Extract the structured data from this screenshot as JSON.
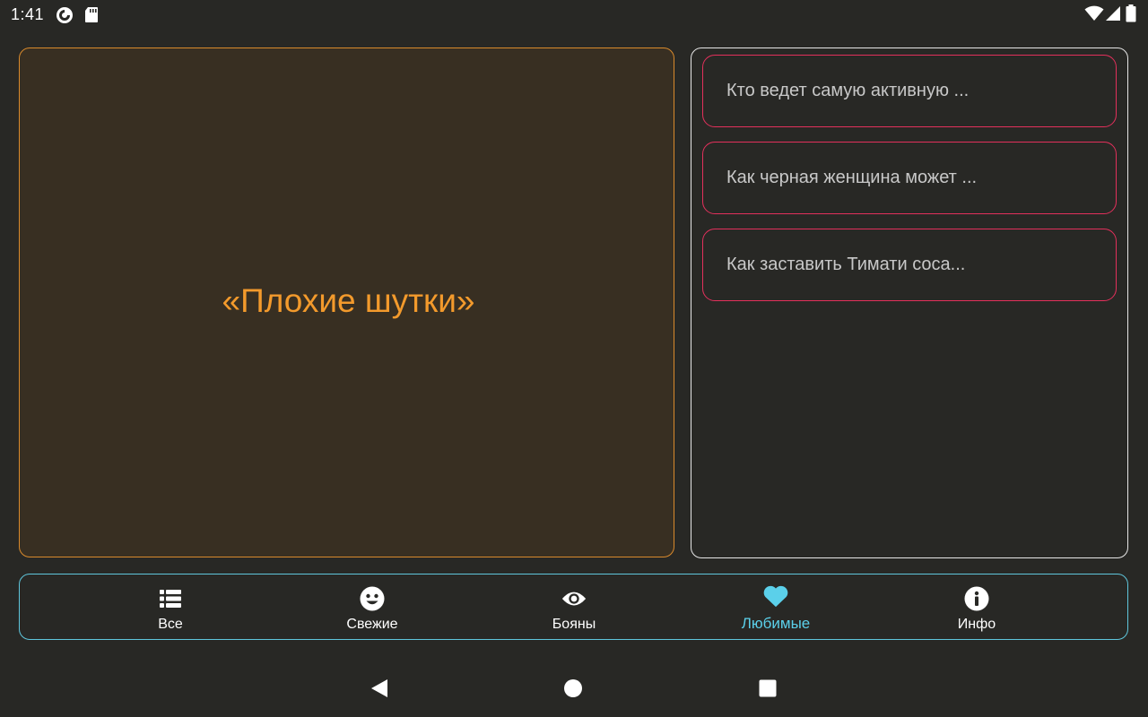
{
  "status_bar": {
    "time": "1:41",
    "icons": [
      "pocket-casts-icon",
      "sd-card-icon",
      "wifi-icon",
      "cell-signal-icon",
      "battery-icon"
    ]
  },
  "main_card": {
    "title": "«Плохие шутки»",
    "accent_color": "#f39a2c"
  },
  "list": {
    "items": [
      {
        "label": "Кто ведет самую активную ..."
      },
      {
        "label": "Как черная женщина может ..."
      },
      {
        "label": "Как заставить Тимати соса..."
      }
    ],
    "border_color": "#e3305c"
  },
  "bottom_nav": {
    "items": [
      {
        "label": "Все",
        "icon": "list-icon",
        "active": false
      },
      {
        "label": "Свежие",
        "icon": "smiley-icon",
        "active": false
      },
      {
        "label": "Бояны",
        "icon": "eye-icon",
        "active": false
      },
      {
        "label": "Любимые",
        "icon": "heart-icon",
        "active": true
      },
      {
        "label": "Инфо",
        "icon": "info-icon",
        "active": false
      }
    ],
    "active_color": "#5bd0ea"
  },
  "system_nav": {
    "buttons": [
      "back-icon",
      "home-icon",
      "recents-icon"
    ]
  }
}
